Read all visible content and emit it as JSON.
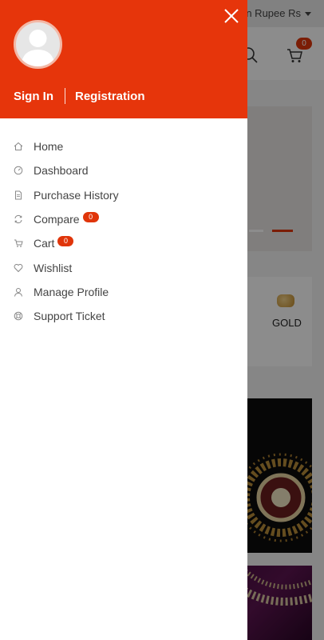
{
  "background": {
    "currency_label": "an Rupee Rs",
    "cart_count": "0",
    "category_label": "GOLD"
  },
  "drawer": {
    "sign_in_label": "Sign In",
    "registration_label": "Registration",
    "menu": [
      {
        "label": "Home",
        "icon": "home-icon"
      },
      {
        "label": "Dashboard",
        "icon": "dashboard-icon"
      },
      {
        "label": "Purchase History",
        "icon": "document-icon"
      },
      {
        "label": "Compare",
        "icon": "compare-icon",
        "badge": "0"
      },
      {
        "label": "Cart",
        "icon": "cart-icon",
        "badge": "0"
      },
      {
        "label": "Wishlist",
        "icon": "heart-icon"
      },
      {
        "label": "Manage Profile",
        "icon": "user-icon"
      },
      {
        "label": "Support Ticket",
        "icon": "support-icon"
      }
    ]
  },
  "colors": {
    "accent": "#e6350b",
    "badge": "#e0350a"
  }
}
